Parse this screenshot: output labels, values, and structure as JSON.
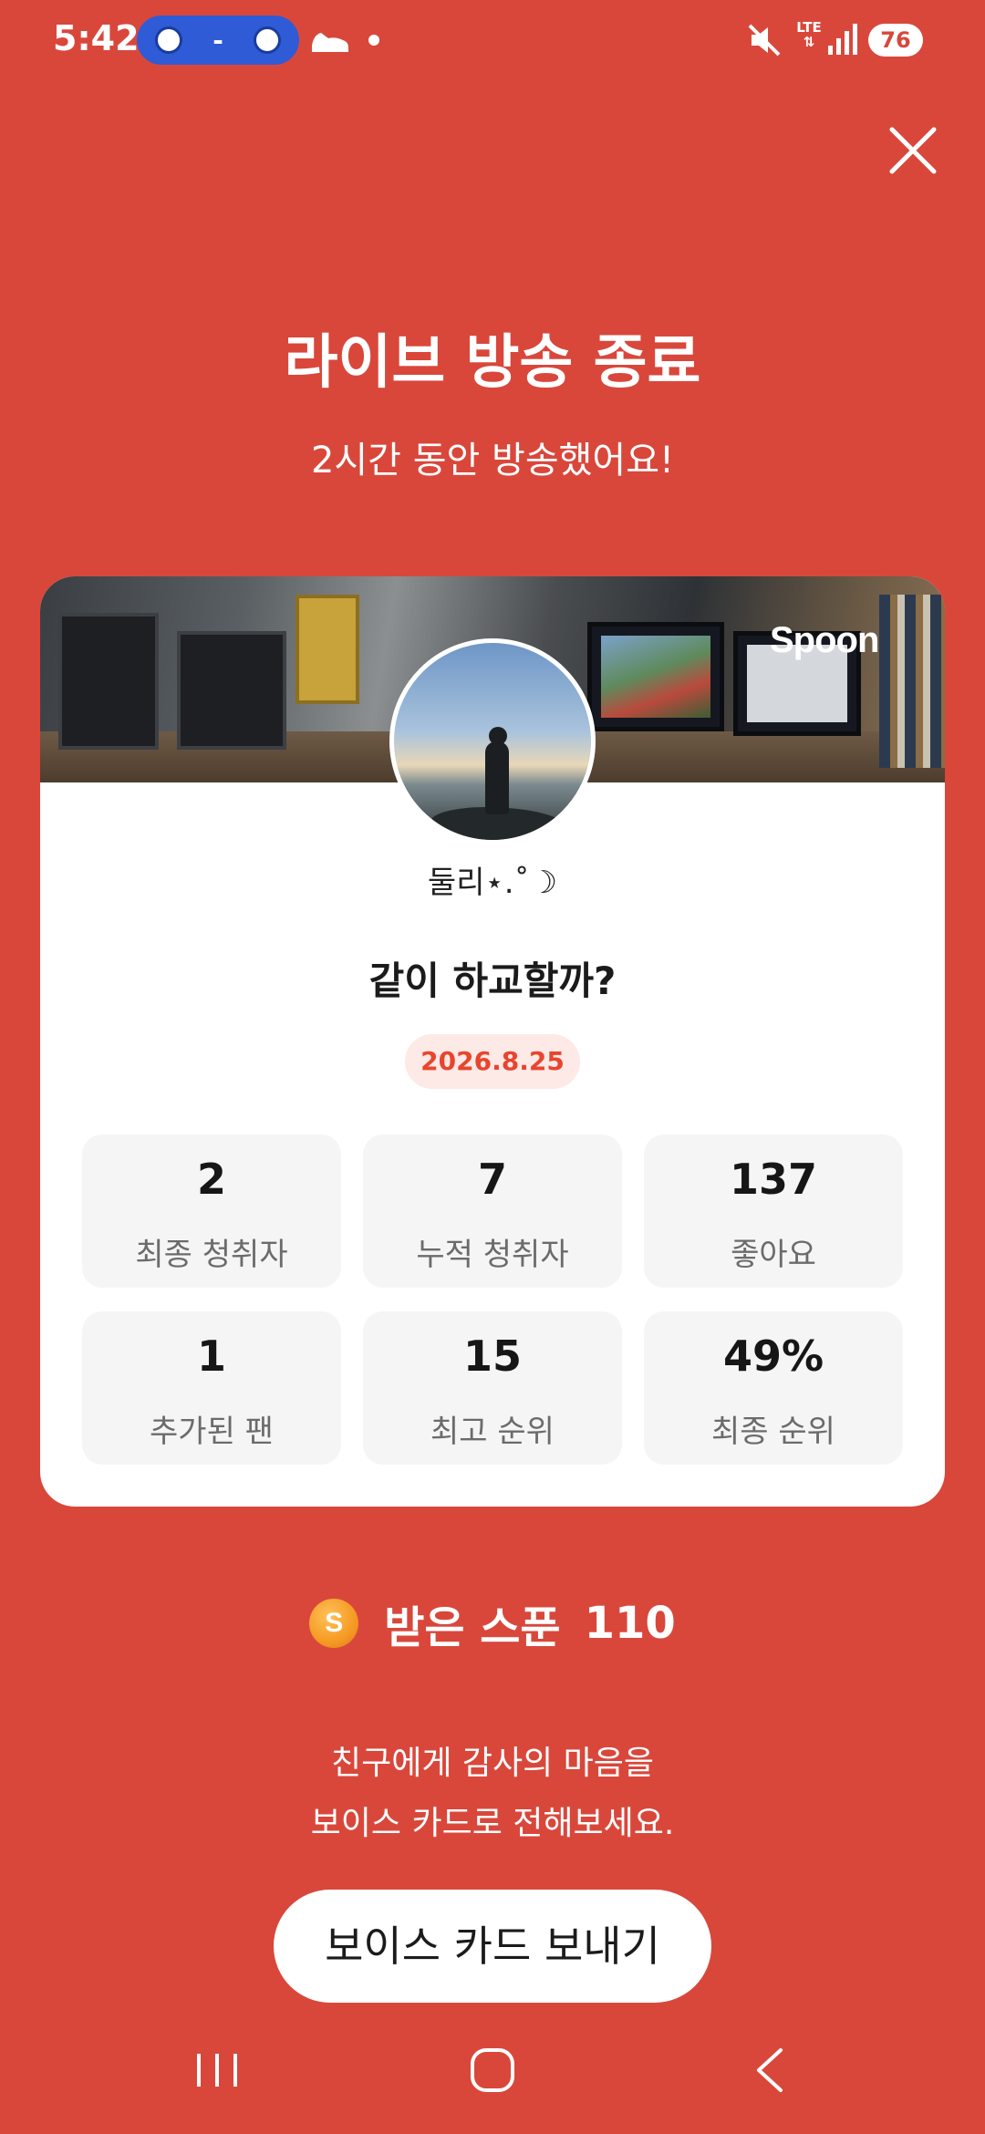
{
  "status_bar": {
    "time": "5:42",
    "score_dash": "-",
    "network": "LTE",
    "battery": "76"
  },
  "header": {
    "title": "라이브 방송 종료",
    "subtitle": "2시간 동안 방송했어요!"
  },
  "card": {
    "brand": "Spoon",
    "nickname": "둘리⋆.˚☽",
    "live_title": "같이 하교할까?",
    "date": "2026.8.25",
    "stats": [
      {
        "value": "2",
        "label": "최종 청취자"
      },
      {
        "value": "7",
        "label": "누적 청취자"
      },
      {
        "value": "137",
        "label": "좋아요"
      },
      {
        "value": "1",
        "label": "추가된 팬"
      },
      {
        "value": "15",
        "label": "최고 순위"
      },
      {
        "value": "49%",
        "label": "최종 순위"
      }
    ]
  },
  "spoons": {
    "coin_letter": "S",
    "label": "받은 스푼",
    "count": "110"
  },
  "message": {
    "line1": "친구에게 감사의 마음을",
    "line2": "보이스 카드로 전해보세요."
  },
  "cta": {
    "label": "보이스 카드 보내기"
  },
  "colors": {
    "background": "#D9473B",
    "date_text": "#E8452E",
    "date_badge_bg": "#FDE9E6",
    "stat_tile_bg": "#F5F5F5",
    "coin": "#F59A23"
  },
  "icons": {
    "close": "close-icon",
    "mute": "mute-icon",
    "signal": "signal-icon",
    "coin": "spoon-coin-icon",
    "nav_recent": "recent-apps-icon",
    "nav_home": "home-icon",
    "nav_back": "back-icon"
  }
}
